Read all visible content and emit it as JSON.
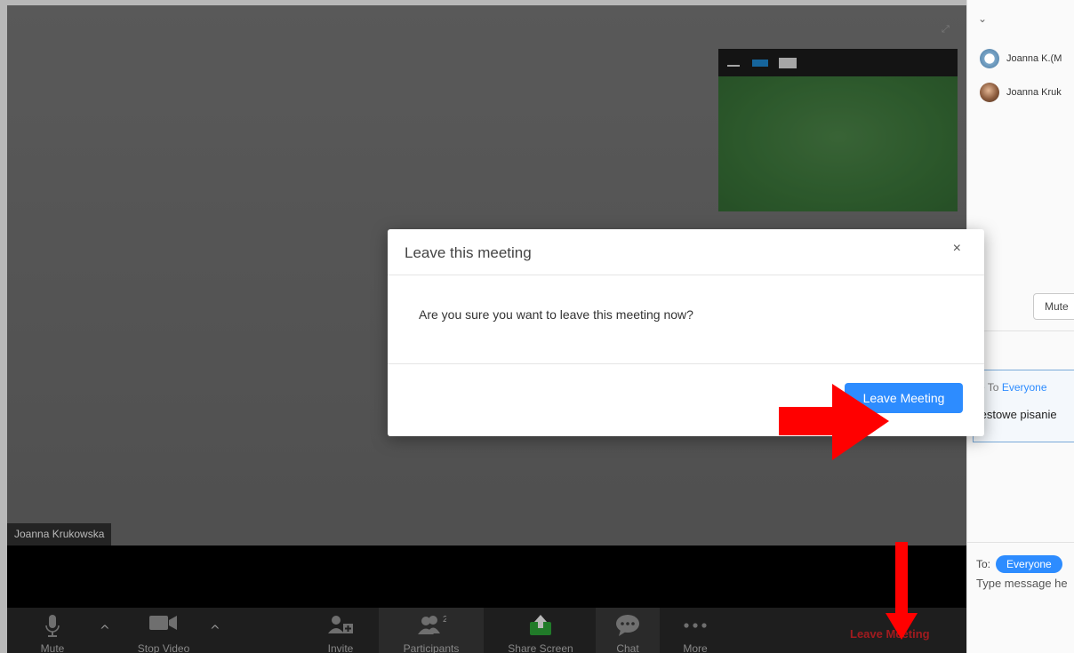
{
  "video": {
    "participant_name": "Joanna Krukowska"
  },
  "toolbar": {
    "mute_label": "Mute",
    "stop_video_label": "Stop Video",
    "invite_label": "Invite",
    "participants_label": "Participants",
    "participants_count": "2",
    "share_screen_label": "Share Screen",
    "chat_label": "Chat",
    "more_label": "More",
    "leave_label": "Leave Meeting"
  },
  "side_panel": {
    "participants": [
      {
        "name": "Joanna K.(M"
      },
      {
        "name": "Joanna Kruk"
      }
    ],
    "mute_button": "Mute",
    "chat_header_prefix": "e To ",
    "chat_header_target": "Everyone",
    "chat_message": "testowe pisanie",
    "to_label": "To:",
    "to_pill": "Everyone",
    "input_placeholder": "Type message he"
  },
  "modal": {
    "title": "Leave this meeting",
    "close_glyph": "×",
    "message": "Are you sure you want to leave this meeting now?",
    "confirm_button": "Leave Meeting"
  },
  "colors": {
    "accent_blue": "#2d8cff",
    "leave_red": "#e0262b",
    "annotation_red": "#ff0000",
    "share_green": "#2eab3a"
  }
}
